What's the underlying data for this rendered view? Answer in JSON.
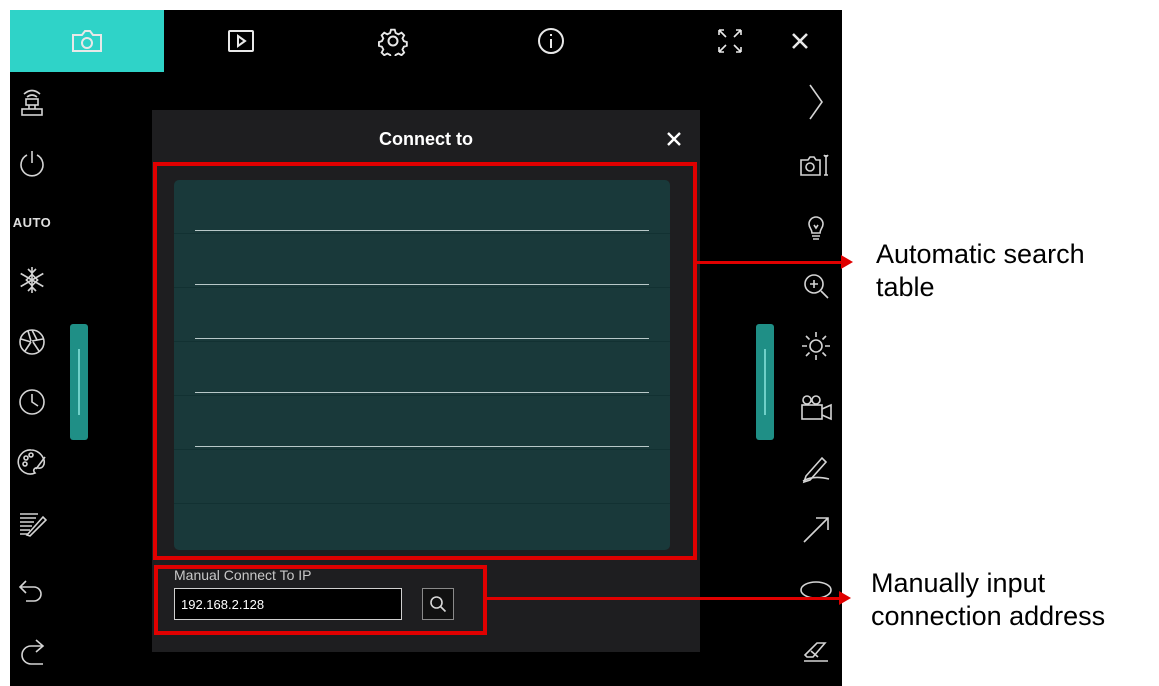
{
  "topbar": {
    "icons": [
      "camera-icon",
      "play-icon",
      "gear-icon",
      "info-icon",
      "fullscreen-icon",
      "close-icon"
    ],
    "active_tab": "camera-icon",
    "accent_color": "#2fd3c8"
  },
  "left_toolbar": {
    "auto_label": "AUTO",
    "icons": [
      "document-camera-icon",
      "power-icon",
      "auto-mode",
      "freeze-icon",
      "aperture-icon",
      "timer-icon",
      "palette-icon",
      "eraser-pattern-icon",
      "undo-icon",
      "redo-icon"
    ]
  },
  "right_toolbar": {
    "icons": [
      "chevron-right-icon",
      "camera-settings-icon",
      "lamp-icon",
      "zoom-in-icon",
      "brightness-icon",
      "video-record-icon",
      "pen-icon",
      "arrow-icon",
      "ellipse-icon",
      "eraser-icon"
    ]
  },
  "dialog": {
    "title": "Connect to",
    "table_rows": [
      "",
      "",
      "",
      "",
      "",
      "",
      ""
    ],
    "manual_label": "Manual Connect To IP",
    "ip_value": "192.168.2.128",
    "table_color": "#19393a"
  },
  "annotations": {
    "search_table": "Automatic search table",
    "manual_input": "Manually input connection address",
    "color": "#e00000"
  }
}
